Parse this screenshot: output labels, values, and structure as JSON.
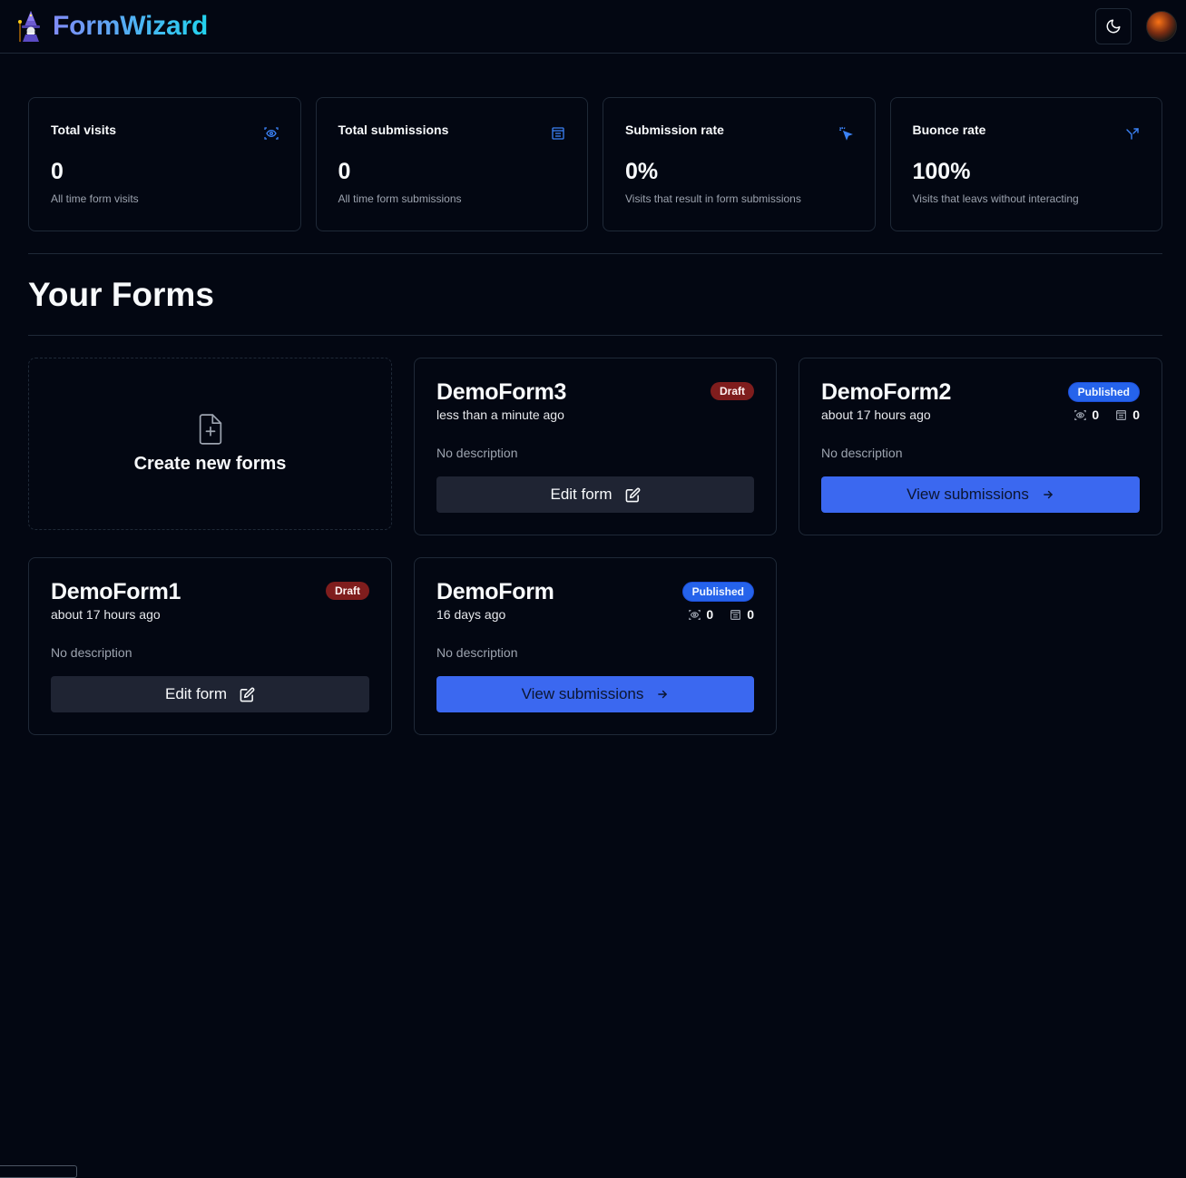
{
  "app": {
    "name": "FormWizard"
  },
  "stats": [
    {
      "title": "Total visits",
      "value": "0",
      "help": "All time form visits",
      "icon": "eye-scan-icon"
    },
    {
      "title": "Total submissions",
      "value": "0",
      "help": "All time form submissions",
      "icon": "form-list-icon"
    },
    {
      "title": "Submission rate",
      "value": "0%",
      "help": "Visits that result in form submissions",
      "icon": "cursor-click-icon"
    },
    {
      "title": "Buonce rate",
      "value": "100%",
      "help": "Visits that leavs without interacting",
      "icon": "split-arrow-icon"
    }
  ],
  "page": {
    "title": "Your Forms"
  },
  "create_card": {
    "label": "Create new forms"
  },
  "forms": [
    {
      "name": "DemoForm3",
      "status": "Draft",
      "time": "less than a minute ago",
      "description": "No description",
      "action": "Edit form"
    },
    {
      "name": "DemoForm2",
      "status": "Published",
      "time": "about 17 hours ago",
      "visits": "0",
      "submissions": "0",
      "description": "No description",
      "action": "View submissions"
    },
    {
      "name": "DemoForm1",
      "status": "Draft",
      "time": "about 17 hours ago",
      "description": "No description",
      "action": "Edit form"
    },
    {
      "name": "DemoForm",
      "status": "Published",
      "time": "16 days ago",
      "visits": "0",
      "submissions": "0",
      "description": "No description",
      "action": "View submissions"
    }
  ],
  "colors": {
    "background": "#030712",
    "accent": "#3b68f0",
    "draft": "#7f1d1d",
    "border": "#1f2937"
  }
}
